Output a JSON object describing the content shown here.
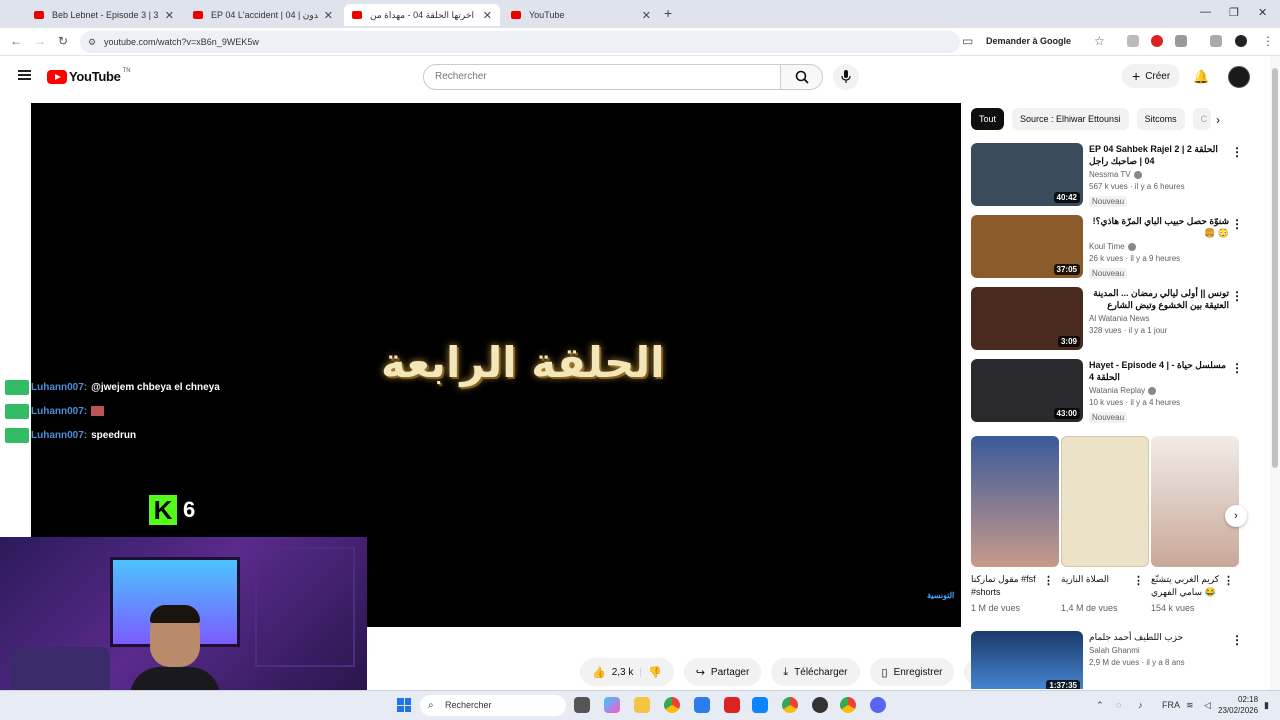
{
  "browser": {
    "tabs": [
      {
        "title": "Beb Lebnet - Episode 3 | 3 الحلقة",
        "active": false
      },
      {
        "title": "EP 04 L'accident | الأكسيدون | 04",
        "active": false
      },
      {
        "title": "هاذي اخرتها الحلقة 04 - مهداة من",
        "active": true
      },
      {
        "title": "YouTube",
        "active": false
      }
    ],
    "url": "youtube.com/watch?v=xB6n_9WEK5w",
    "ask_google": "Demander à Google"
  },
  "header": {
    "logo_text": "YouTube",
    "logo_region": "TN",
    "search_placeholder": "Rechercher",
    "create_label": "Créer"
  },
  "player": {
    "title_card": "الحلقة الرابعة",
    "watermark": "التونسية"
  },
  "overlay": {
    "chat": [
      {
        "user": "Luhann007:",
        "message": "@jwejem chbeya el chneya",
        "emote": false
      },
      {
        "user": "Luhann007:",
        "message": "",
        "emote": true
      },
      {
        "user": "Luhann007:",
        "message": "speedrun",
        "emote": false
      }
    ],
    "kick_logo": "K",
    "kick_count": "6"
  },
  "actions": {
    "likes": "2,3 k",
    "share": "Partager",
    "download": "Télécharger",
    "save": "Enregistrer"
  },
  "chips": [
    "Tout",
    "Source : Elhiwar Ettounsi",
    "Sitcoms",
    "C"
  ],
  "recommendations": [
    {
      "title": "EP 04 Sahbek Rajel 2 | 2 الحلقة 04 | صاحبك راجل",
      "channel": "Nessma TV",
      "verified": true,
      "meta": "567 k vues · il y a 6 heures",
      "badge": "Nouveau",
      "duration": "40:42",
      "thumb_color": "#3a4b5c"
    },
    {
      "title": "شنوّة حصل حبيب الباي المرّة هاذي؟! 😳 🍔",
      "channel": "Koul Time",
      "verified": true,
      "meta": "26 k vues · il y a 9 heures",
      "badge": "Nouveau",
      "duration": "37:05",
      "thumb_color": "#8a5a2a"
    },
    {
      "title": "تونس || أولى ليالي رمضان ... المدينة العتيقة بين الخشوع وتبض الشارع",
      "channel": "Al Watania News",
      "verified": false,
      "meta": "328 vues · il y a 1 jour",
      "badge": "",
      "duration": "3:09",
      "thumb_color": "#4a2a1e"
    },
    {
      "title": "Hayet - Episode 4 | مسلسل حياة - الحلقة 4",
      "channel": "Watania Replay",
      "verified": true,
      "meta": "10 k vues · il y a 4 heures",
      "badge": "Nouveau",
      "duration": "43:00",
      "thumb_color": "#2a2a2e"
    }
  ],
  "shorts": [
    {
      "title": "مقول تمارکنا #fsf #shorts",
      "views": "1 M de vues",
      "thumb_color": "#6a4a8a"
    },
    {
      "title": "الصلاة النارية",
      "views": "1,4 M de vues",
      "thumb_color": "#e8dcc0"
    },
    {
      "title": "كريم الغربي يتشنّع سامي الفهري 😂",
      "views": "154 k vues",
      "thumb_color": "#d8c8c0"
    }
  ],
  "last_rec": {
    "title": "حزب اللطيف   أحمد جلمام",
    "channel": "Salah Ghanmi",
    "meta": "2,9 M de vues · il y a 8 ans",
    "duration": "1:37:35",
    "thumb_color": "#1a3a6a"
  },
  "taskbar": {
    "search_placeholder": "Rechercher",
    "language": "FRA",
    "time": "02:18",
    "date": "23/02/2026"
  }
}
